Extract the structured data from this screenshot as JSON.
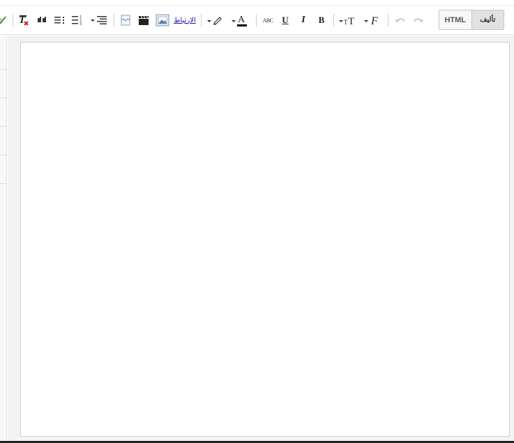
{
  "toolbar": {
    "link_label": "الارتباط",
    "spellcheck_label": "ABC",
    "underline_label": "U",
    "italic_label": "I",
    "bold_label": "B",
    "font_size_label": "T",
    "font_label": "F",
    "text_color_label": "A"
  },
  "mode_switch": {
    "html_label": "HTML",
    "compose_label": "تأليف",
    "active": "compose"
  },
  "editor": {
    "content": ""
  },
  "colors": {
    "link": "#1a0dab",
    "remove_format_x": "#cc2222",
    "text_color_bar": "#000000"
  }
}
